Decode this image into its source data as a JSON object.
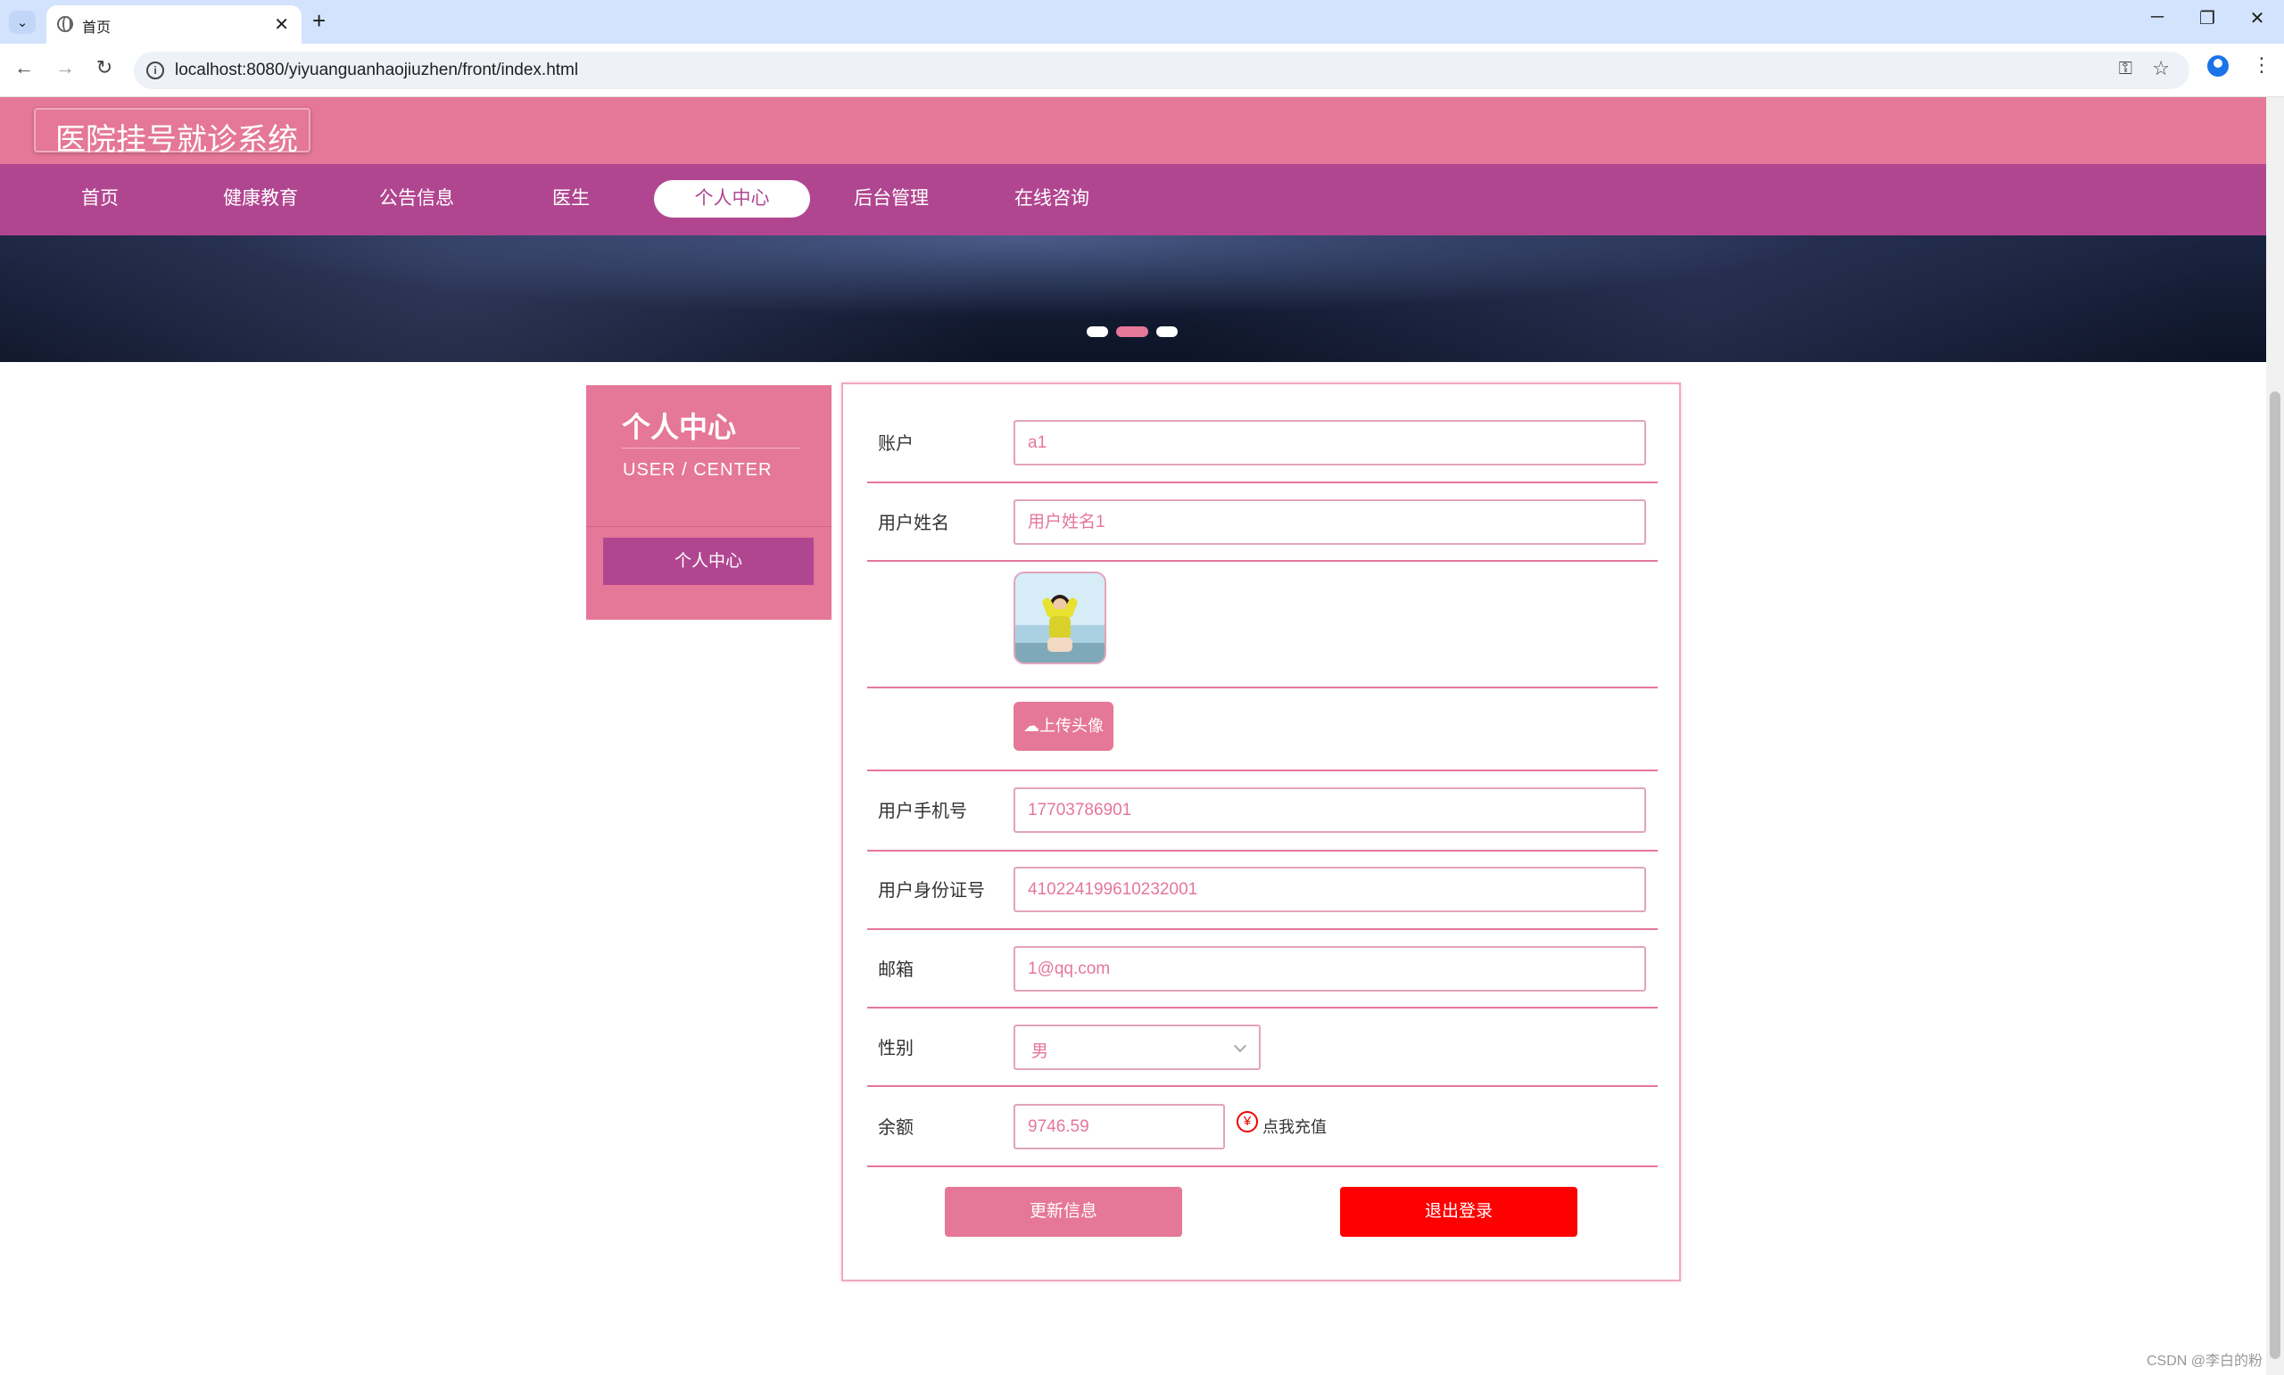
{
  "browser": {
    "tab_title": "首页",
    "url": "localhost:8080/yiyuanguanhaojiuzhen/front/index.html"
  },
  "header": {
    "site_title": "医院挂号就诊系统"
  },
  "nav": {
    "items": [
      {
        "label": "首页"
      },
      {
        "label": "健康教育"
      },
      {
        "label": "公告信息"
      },
      {
        "label": "医生"
      },
      {
        "label": "个人中心",
        "active": true
      },
      {
        "label": "后台管理"
      },
      {
        "label": "在线咨询"
      }
    ]
  },
  "banner": {
    "dots": 3,
    "active_dot": 2
  },
  "sidebar": {
    "title": "个人中心",
    "subtitle": "USER / CENTER",
    "menu_item": "个人中心"
  },
  "form": {
    "account_label": "账户",
    "account_value": "a1",
    "name_label": "用户姓名",
    "name_value": "用户姓名1",
    "upload_label": "上传头像",
    "phone_label": "用户手机号",
    "phone_value": "17703786901",
    "idcard_label": "用户身份证号",
    "idcard_value": "410224199610232001",
    "email_label": "邮箱",
    "email_value": "1@qq.com",
    "gender_label": "性别",
    "gender_value": "男",
    "balance_label": "余额",
    "balance_value": "9746.59",
    "recharge_link": "点我充值",
    "update_button": "更新信息",
    "logout_button": "退出登录"
  },
  "watermark": "CSDN @李白的粉",
  "colors": {
    "primary_pink": "#e57798",
    "nav_purple": "#b14690",
    "danger_red": "#ff0000"
  }
}
